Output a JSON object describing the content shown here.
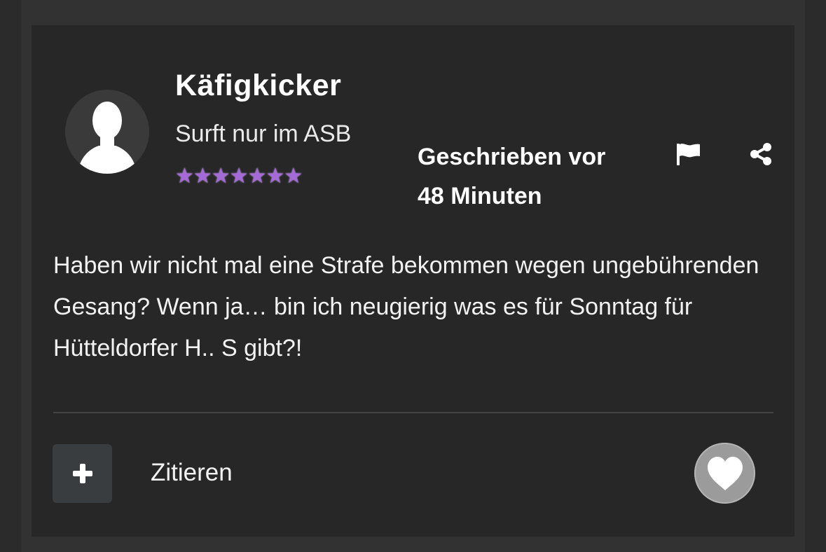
{
  "post": {
    "author": {
      "name": "Käfigkicker",
      "rank": "Surft nur im ASB",
      "stars": "★★★★★★★",
      "star_color": "#a56ad8"
    },
    "posted_line1": "Geschrieben vor",
    "posted_line2": "48 Minuten",
    "body": "Haben wir nicht mal eine Strafe bekommen wegen ungebührenden Gesang? Wenn ja… bin ich neugierig was es für Sonntag für Hütteldorfer H.. S gibt?!",
    "icons": {
      "report": "flag-icon",
      "share": "share-icon",
      "multiquote": "plus-icon",
      "like": "heart-icon"
    }
  },
  "actions": {
    "quote_label": "Zitieren"
  }
}
